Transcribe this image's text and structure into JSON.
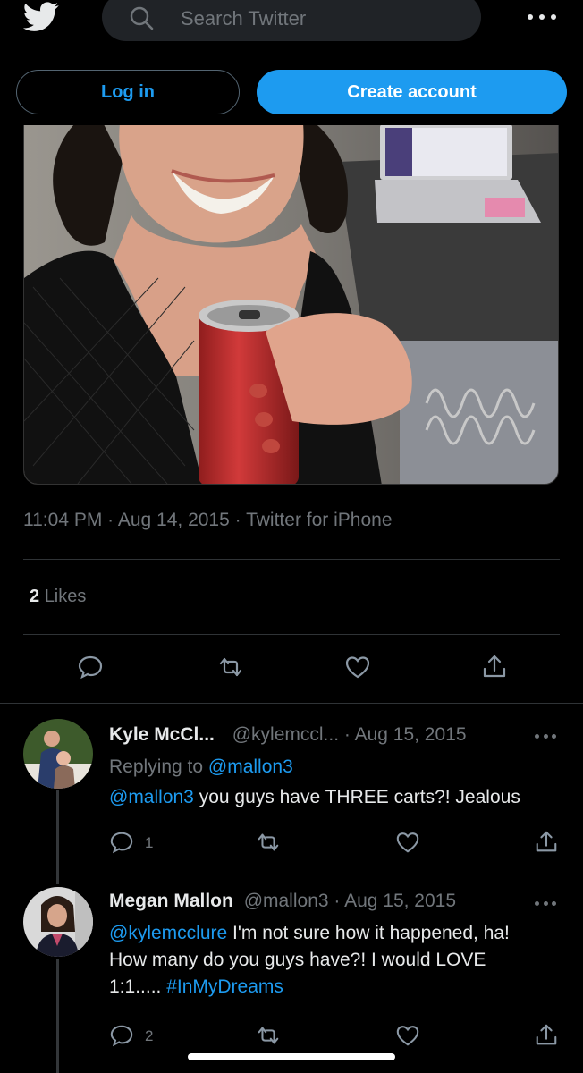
{
  "header": {
    "search_placeholder": "Search Twitter",
    "login_label": "Log in",
    "create_label": "Create account"
  },
  "tweet": {
    "time": "11:04 PM",
    "date": "Aug 14, 2015",
    "source": "Twitter for iPhone",
    "likes_count": "2",
    "likes_label": "Likes"
  },
  "replies": [
    {
      "name": "Kyle McCl...",
      "handle": "@kylemccl...",
      "date": "Aug 15, 2015",
      "replying_label": "Replying to",
      "replying_to": "@mallon3",
      "mention": "@mallon3",
      "text": " you guys have THREE carts?! Jealous",
      "reply_count": "1"
    },
    {
      "name": "Megan Mallon",
      "handle": "@mallon3",
      "date": "Aug 15, 2015",
      "mention": "@kylemcclure",
      "text_line1": " I'm not sure how it happened, ha!",
      "text_line2": "How many do you guys have?!  I would LOVE",
      "text_line3": "1:1..... ",
      "hashtag": "#InMyDreams",
      "reply_count": "2"
    }
  ],
  "icons": [
    "twitter-logo-icon",
    "search-icon",
    "more-icon",
    "reply-icon",
    "retweet-icon",
    "like-icon",
    "share-icon"
  ],
  "colors": {
    "accent": "#1d9bf0",
    "background": "#000000",
    "muted": "#71767b",
    "text": "#e7e9ea"
  }
}
